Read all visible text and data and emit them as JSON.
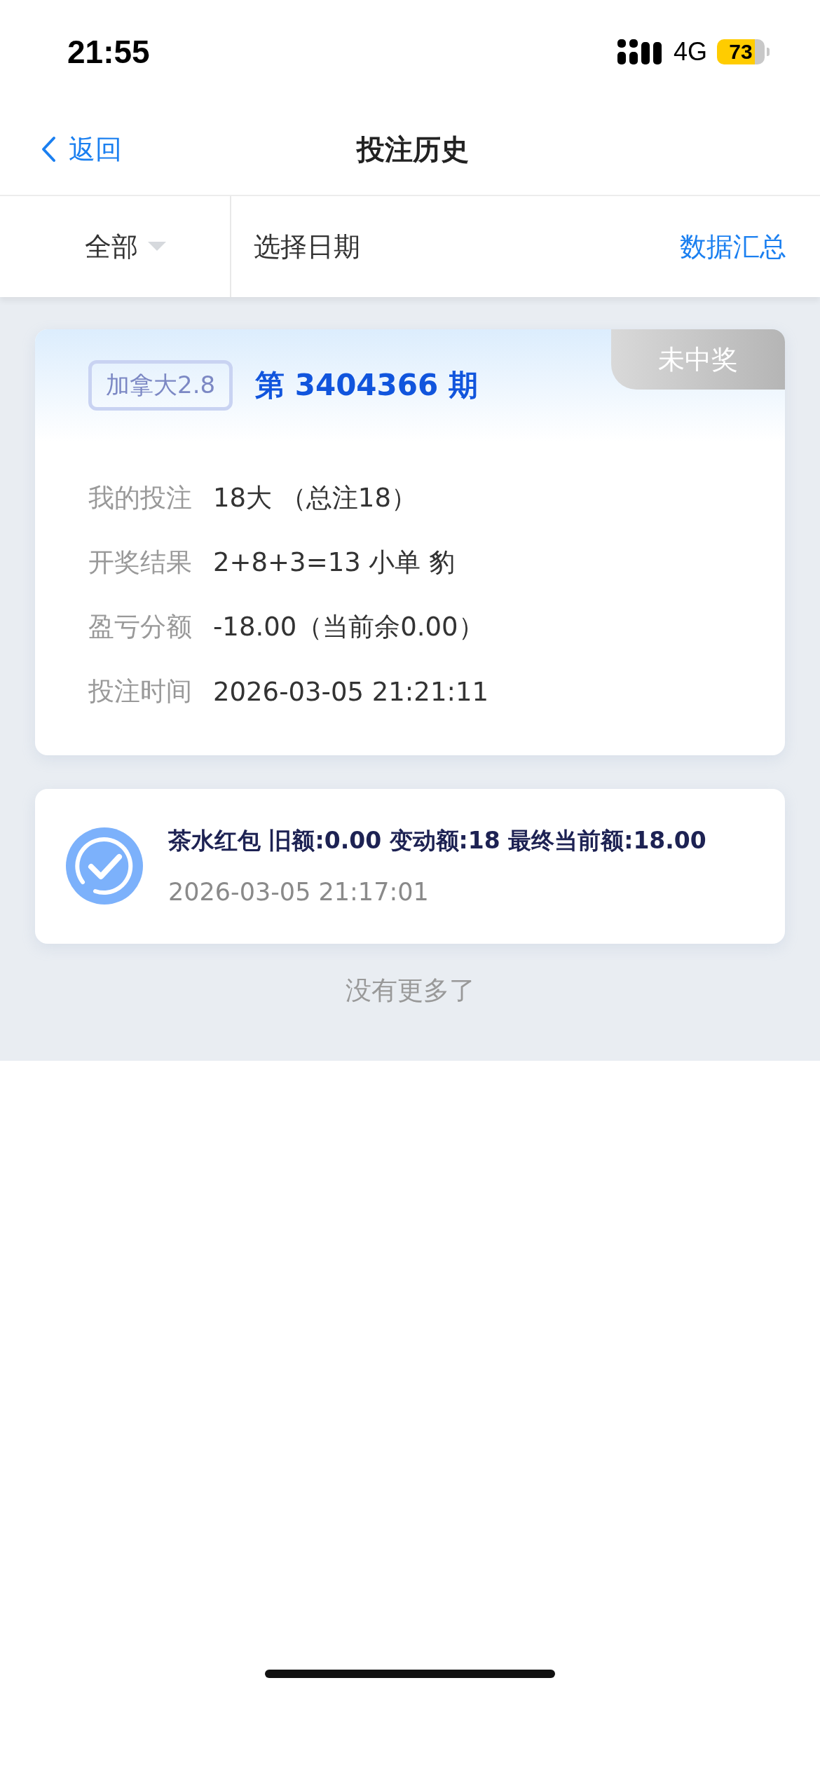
{
  "status_bar": {
    "time": "21:55",
    "network": "4G",
    "battery": "73"
  },
  "nav": {
    "back": "返回",
    "title": "投注历史"
  },
  "filter": {
    "category": "全部",
    "date": "选择日期",
    "summary": "数据汇总"
  },
  "bets": [
    {
      "tag": "加拿大2.8",
      "period": "第 3404366 期",
      "status": "未中奖",
      "rows": [
        {
          "label": "我的投注",
          "value": "18大 （总注18）"
        },
        {
          "label": "开奖结果",
          "value": "2+8+3=13 小单 豹"
        },
        {
          "label": "盈亏分额",
          "value": "-18.00（当前余0.00）"
        },
        {
          "label": "投注时间",
          "value": "2026-03-05 21:21:11"
        }
      ]
    }
  ],
  "records": [
    {
      "text": "茶水红包 旧额:0.00 变动额:18 最终当前额:18.00",
      "time": "2026-03-05 21:17:01"
    }
  ],
  "footer": "没有更多了"
}
